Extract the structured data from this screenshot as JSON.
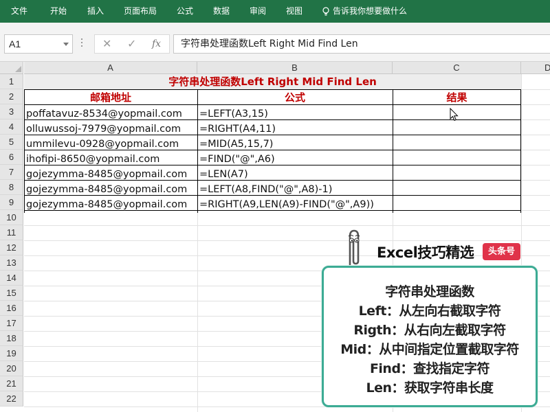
{
  "ribbon": {
    "tabs": [
      "文件",
      "开始",
      "插入",
      "页面布局",
      "公式",
      "数据",
      "审阅",
      "视图"
    ],
    "tell_me": "告诉我你想要做什么",
    "bg_color": "#217346"
  },
  "formula_bar": {
    "name_box": "A1",
    "cancel_icon": "✕",
    "enter_icon": "✓",
    "fx_label": "fx",
    "content": "字符串处理函数Left Right Mid Find Len"
  },
  "columns": [
    "A",
    "B",
    "C",
    "D"
  ],
  "rows": [
    "1",
    "2",
    "3",
    "4",
    "5",
    "6",
    "7",
    "8",
    "9",
    "10",
    "11",
    "12",
    "13",
    "14",
    "15",
    "16",
    "17",
    "18",
    "19",
    "20",
    "21",
    "22"
  ],
  "sheet": {
    "title": "字符串处理函数Left Right Mid Find Len",
    "headers": [
      "邮箱地址",
      "公式",
      "结果"
    ],
    "data": [
      {
        "email": "poffatavuz-8534@yopmail.com",
        "formula": "=LEFT(A3,15)",
        "result": ""
      },
      {
        "email": "olluwussoj-7979@yopmail.com",
        "formula": "=RIGHT(A4,11)",
        "result": ""
      },
      {
        "email": "ummilevu-0928@yopmail.com",
        "formula": "=MID(A5,15,7)",
        "result": ""
      },
      {
        "email": "ihofipi-8650@yopmail.com",
        "formula": "=FIND(\"@\",A6)",
        "result": ""
      },
      {
        "email": "gojezymma-8485@yopmail.com",
        "formula": "=LEN(A7)",
        "result": ""
      },
      {
        "email": "gojezymma-8485@yopmail.com",
        "formula": "=LEFT(A8,FIND(\"@\",A8)-1)",
        "result": ""
      },
      {
        "email": "gojezymma-8485@yopmail.com",
        "formula": "=RIGHT(A9,LEN(A9)-FIND(\"@\",A9))",
        "result": ""
      }
    ],
    "accent_color": "#c00000"
  },
  "overlay": {
    "brand": "Excel技巧精选",
    "badge": "头条号",
    "panel_lines": [
      "字符串处理函数",
      "Left：从左向右截取字符",
      "Rigth：从右向左截取字符",
      "Mid：从中间指定位置截取字符",
      "Find：查找指定字符",
      "Len：获取字符串长度"
    ],
    "panel_border_color": "#3cab94",
    "badge_color": "#e0334a"
  }
}
